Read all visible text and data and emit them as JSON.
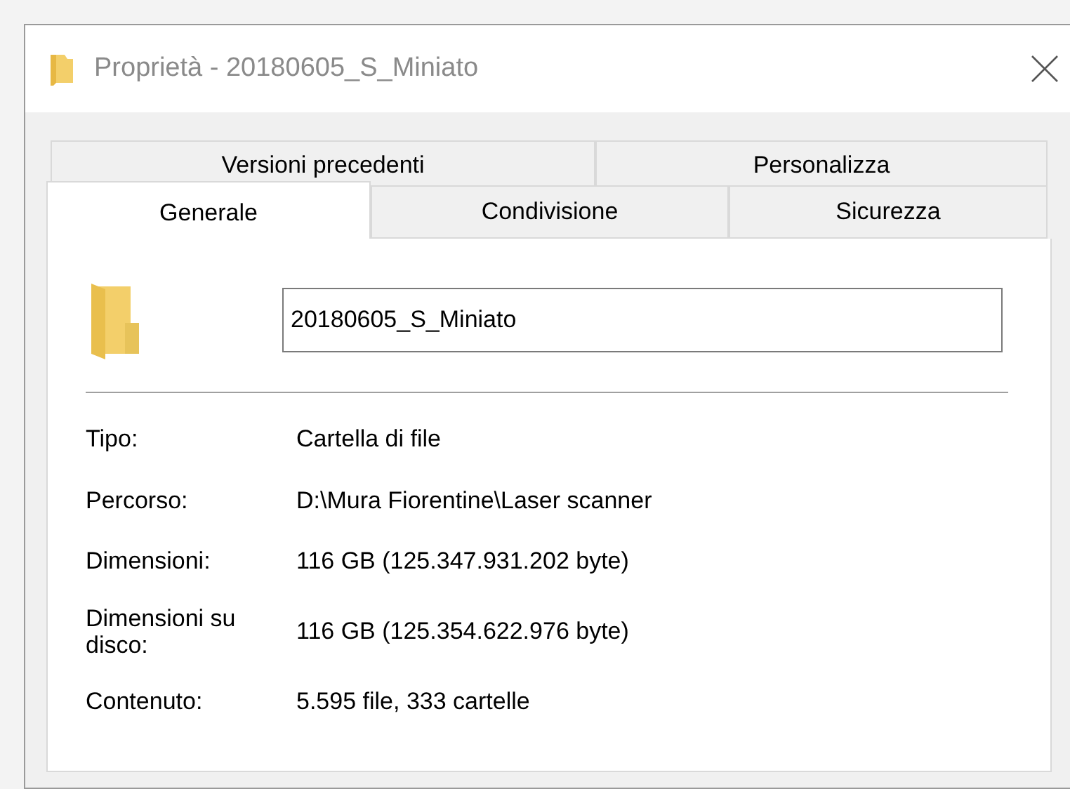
{
  "window": {
    "title": "Proprietà - 20180605_S_Miniato"
  },
  "tab_rows": [
    [
      {
        "label": "Versioni precedenti",
        "selected": false
      },
      {
        "label": "Personalizza",
        "selected": false
      }
    ],
    [
      {
        "label": "Generale",
        "selected": true
      },
      {
        "label": "Condivisione",
        "selected": false
      },
      {
        "label": "Sicurezza",
        "selected": false
      }
    ]
  ],
  "name_field": {
    "value": "20180605_S_Miniato"
  },
  "properties": [
    {
      "label": "Tipo:",
      "value": "Cartella di file"
    },
    {
      "label": "Percorso:",
      "value": "D:\\Mura Fiorentine\\Laser scanner"
    },
    {
      "label": "Dimensioni:",
      "value": "116 GB (125.347.931.202 byte)"
    },
    {
      "label": "Dimensioni su disco:",
      "value": "116 GB (125.354.622.976 byte)"
    },
    {
      "label": "Contenuto:",
      "value": "5.595 file, 333 cartelle"
    }
  ]
}
